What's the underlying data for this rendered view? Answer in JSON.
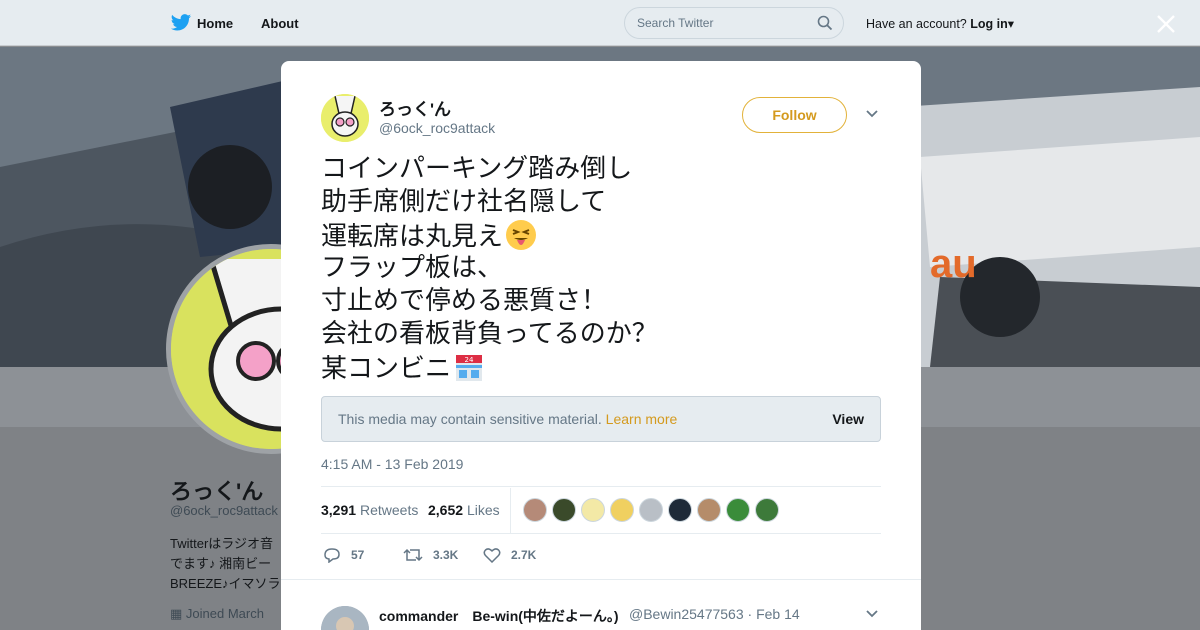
{
  "topbar": {
    "home_label": "Home",
    "about_label": "About",
    "search_placeholder": "Search Twitter",
    "account_prompt": "Have an account?",
    "login_label": "Log in"
  },
  "profile": {
    "name": "ろっく'ん",
    "handle": "@6ock_roc9attack",
    "bio_lines": [
      "Twitterはラジオ音",
      "でます♪ 湘南ビー",
      "BREEZE♪イマソラ"
    ],
    "joined": "Joined March"
  },
  "tweet": {
    "author_name": "ろっく'ん",
    "author_handle": "@6ock_roc9attack",
    "follow_label": "Follow",
    "text_lines": [
      "コインパーキング踏み倒し",
      "助手席側だけ社名隠して",
      "運転席は丸見え",
      "フラップ板は、",
      "寸止めで停める悪質さ！",
      "会社の看板背負ってるのか？",
      "某コンビニ"
    ],
    "sensitive_notice": "This media may contain sensitive material.",
    "learn_more": "Learn more",
    "view_label": "View",
    "timestamp": "4:15 AM - 13 Feb 2019",
    "retweets_count": "3,291",
    "retweets_label": "Retweets",
    "likes_count": "2,652",
    "likes_label": "Likes",
    "reply_count": "57",
    "retweet_action_count": "3.3K",
    "like_action_count": "2.7K",
    "accent_color": "#d49a1e"
  },
  "reply": {
    "name": "commander　Be-win(中佐だよーん。)",
    "handle": "@Bewin25477563 · Feb 14"
  },
  "likers": [
    {
      "color": "#b58a78"
    },
    {
      "color": "#3a4a2a"
    },
    {
      "color": "#f3e9a6"
    },
    {
      "color": "#f0d060"
    },
    {
      "color": "#b9bfc6"
    },
    {
      "color": "#1e2a38"
    },
    {
      "color": "#b58c6a"
    },
    {
      "color": "#3a8c3a"
    },
    {
      "color": "#3d7a3a"
    }
  ]
}
